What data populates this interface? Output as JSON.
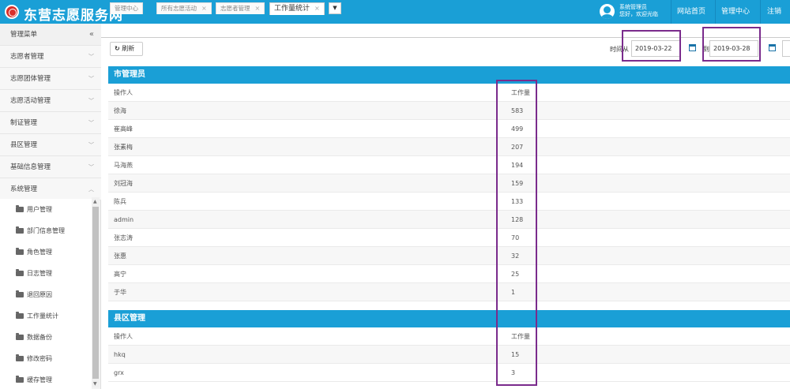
{
  "header": {
    "app_title": "东营志愿服务网",
    "user_role": "系统管理员",
    "user_greeting": "您好，欢迎光临",
    "nav": [
      "网站首页",
      "管理中心",
      "注销"
    ]
  },
  "sidebar": {
    "title": "管理菜单",
    "collapse_glyph": "«",
    "items": [
      {
        "label": "志愿者管理",
        "chevron": "﹀"
      },
      {
        "label": "志愿团体管理",
        "chevron": "﹀"
      },
      {
        "label": "志愿活动管理",
        "chevron": "﹀"
      },
      {
        "label": "制证管理",
        "chevron": "﹀"
      },
      {
        "label": "县区管理",
        "chevron": "﹀"
      },
      {
        "label": "基础信息管理",
        "chevron": "﹀"
      },
      {
        "label": "系统管理",
        "chevron": "︿"
      }
    ],
    "sub_items": [
      "用户管理",
      "部门信息管理",
      "角色管理",
      "日志管理",
      "退回原因",
      "工作量统计",
      "数据备份",
      "修改密码",
      "缓存管理"
    ]
  },
  "tabs": [
    {
      "label": "管理中心",
      "closable": false
    },
    {
      "label": "所有志愿活动",
      "closable": true
    },
    {
      "label": "志愿者管理",
      "closable": true
    },
    {
      "label": "工作量统计",
      "closable": true,
      "active": true
    }
  ],
  "tab_close_glyph": "×",
  "tab_dropdown_glyph": "▼",
  "toolbar": {
    "refresh_label": "刷新",
    "refresh_glyph": "↻",
    "time_from_label": "时间从",
    "time_to_label": "到",
    "date_from": "2019-03-22",
    "date_to": "2019-03-28"
  },
  "city_section": {
    "title": "市管理员",
    "col_operator": "操作人",
    "col_workload": "工作量",
    "rows": [
      {
        "name": "徐海",
        "count": "583"
      },
      {
        "name": "崔高峰",
        "count": "499"
      },
      {
        "name": "张素梅",
        "count": "207"
      },
      {
        "name": "马海燕",
        "count": "194"
      },
      {
        "name": "刘冠海",
        "count": "159"
      },
      {
        "name": "陈兵",
        "count": "133"
      },
      {
        "name": "admin",
        "count": "128"
      },
      {
        "name": "张志涛",
        "count": "70"
      },
      {
        "name": "张惠",
        "count": "32"
      },
      {
        "name": "高宁",
        "count": "25"
      },
      {
        "name": "于华",
        "count": "1"
      }
    ]
  },
  "county_section": {
    "title": "县区管理",
    "col_operator": "操作人",
    "col_workload": "工作量",
    "rows": [
      {
        "name": "hkq",
        "count": "15"
      },
      {
        "name": "grx",
        "count": "3"
      }
    ]
  },
  "colors": {
    "header_blue": "#1a9fd6",
    "highlight_purple": "#7a2b8c",
    "logo_red": "#d9302c"
  }
}
